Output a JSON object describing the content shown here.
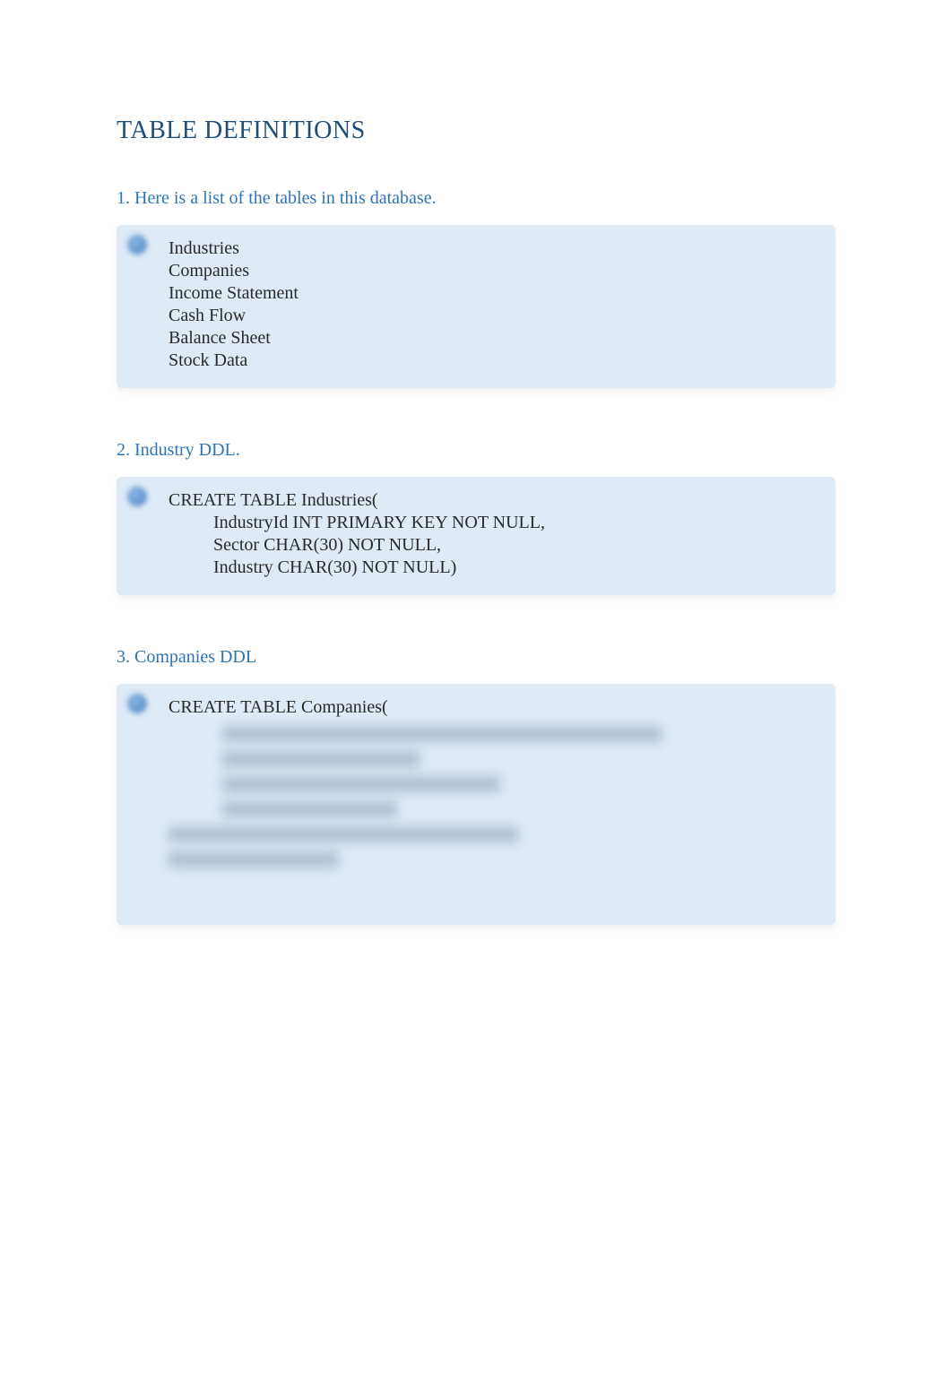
{
  "title": "TABLE DEFINITIONS",
  "sections": [
    {
      "heading": "1. Here is a list of the tables in this database.",
      "code": "Industries\nCompanies\nIncome Statement\nCash Flow\nBalance Sheet\nStock Data"
    },
    {
      "heading": "2.  Industry  DDL.",
      "code": "CREATE TABLE Industries(\n          IndustryId INT PRIMARY KEY NOT NULL,\n          Sector CHAR(30) NOT NULL,\n          Industry CHAR(30) NOT NULL)"
    },
    {
      "heading": "3.  Companies  DDL",
      "code_visible": "CREATE TABLE Companies("
    }
  ]
}
